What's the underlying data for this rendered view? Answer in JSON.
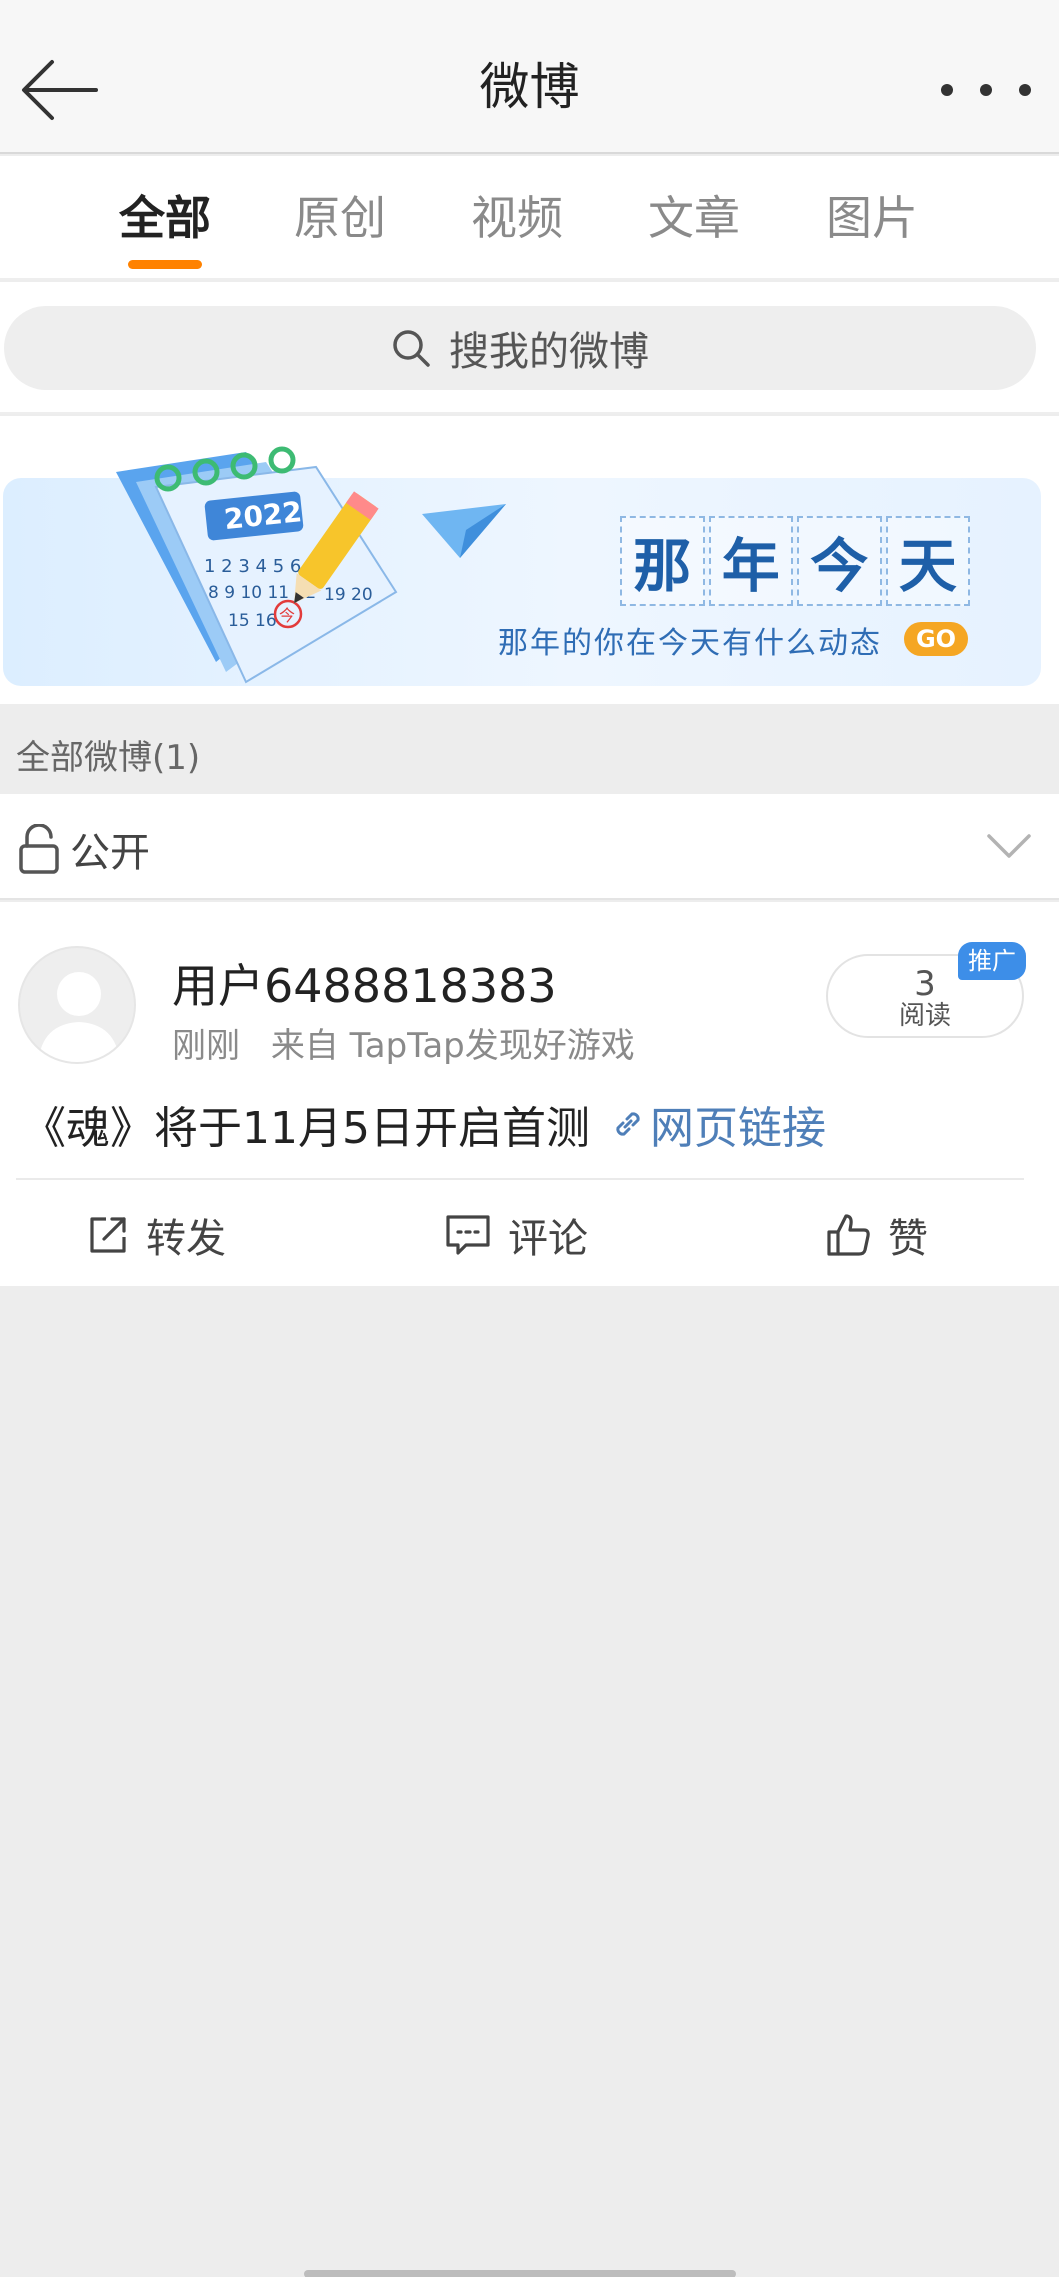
{
  "header": {
    "title": "微博"
  },
  "tabs": [
    {
      "label": "全部",
      "active": true
    },
    {
      "label": "原创",
      "active": false
    },
    {
      "label": "视频",
      "active": false
    },
    {
      "label": "文章",
      "active": false
    },
    {
      "label": "图片",
      "active": false
    }
  ],
  "search": {
    "placeholder": "搜我的微博"
  },
  "banner": {
    "calendar_year": "2022",
    "calendar_numbers": [
      "1 2 3 4 5 6",
      "8 9 10 11 12",
      "15 16",
      "19 20"
    ],
    "calendar_today": "今",
    "title_chars": [
      "那",
      "年",
      "今",
      "天"
    ],
    "subtitle": "那年的你在今天有什么动态",
    "go_label": "GO"
  },
  "section": {
    "title": "全部微博(1)"
  },
  "filter": {
    "label": "公开"
  },
  "post": {
    "username": "用户6488818383",
    "time": "刚刚",
    "source": "来自 TapTap发现好游戏",
    "read_count": "3",
    "read_label": "阅读",
    "promo_label": "推广",
    "text": "《魂》将于11月5日开启首测",
    "link_label": "网页链接",
    "actions": {
      "repost": "转发",
      "comment": "评论",
      "like": "赞"
    }
  },
  "colors": {
    "accent": "#ff8200",
    "link": "#4f7fb8",
    "promo": "#3d8ee8",
    "background": "#ededed"
  }
}
